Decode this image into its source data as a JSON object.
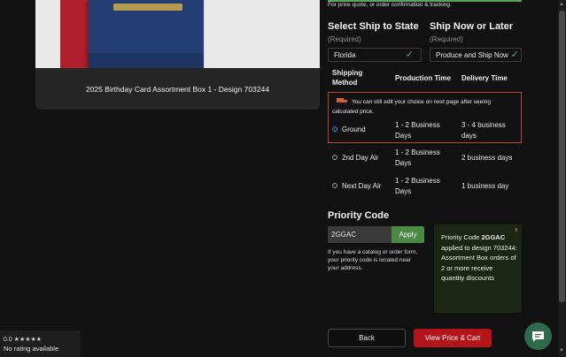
{
  "product": {
    "title": "2025 Birthday Card Assortment Box 1 - Design 703244"
  },
  "rating": {
    "score_stars": "0.0 ★★★★★",
    "no_rating": "No rating available"
  },
  "quote_note": "For price quote, or order confirmation & tracking.",
  "ship_state": {
    "title": "Select Ship to State",
    "required": "(Required)",
    "value": "Florida"
  },
  "ship_time": {
    "title": "Ship Now or Later",
    "required": "(Required)",
    "value": "Produce and Ship Now"
  },
  "shipping_table": {
    "headers": {
      "method_line1": "Shipping",
      "method_line2": "Method",
      "production": "Production Time",
      "delivery": "Delivery Time"
    },
    "edit_note": "You can still edit your choice on next page after seeing calculated price.",
    "rows": [
      {
        "method": "Ground",
        "production_l1": "1 - 2 Business",
        "production_l2": "Days",
        "delivery_l1": "3 - 4 business",
        "delivery_l2": "days",
        "selected": true
      },
      {
        "method": "2nd Day Air",
        "production_l1": "1 - 2 Business",
        "production_l2": "Days",
        "delivery_l1": "2 business days",
        "delivery_l2": "",
        "selected": false
      },
      {
        "method": "Next Day Air",
        "production_l1": "1 - 2 Business",
        "production_l2": "Days",
        "delivery_l1": "1 business day",
        "delivery_l2": "",
        "selected": false
      }
    ]
  },
  "priority": {
    "title": "Priority Code",
    "code_value": "2GGAC",
    "apply_label": "Apply",
    "catalog_note": "If you have a catalog or order form, your priority code is located near your address.",
    "popup": {
      "close": "x",
      "text_prefix": "Priority Code ",
      "code_bold": "2GGAC",
      "text_suffix": " applied to design 703244: Assortment Box orders of 2 or more receive quantity discounts"
    }
  },
  "actions": {
    "back_label": "Back",
    "view_price_label": "View Price & Cart"
  },
  "icons": {
    "check": "check-icon",
    "truck": "truck-icon",
    "chat": "chat-icon"
  },
  "colors": {
    "accent_green": "#4a8a45",
    "cta_red": "#b3151b",
    "highlight_border": "#b54830"
  }
}
